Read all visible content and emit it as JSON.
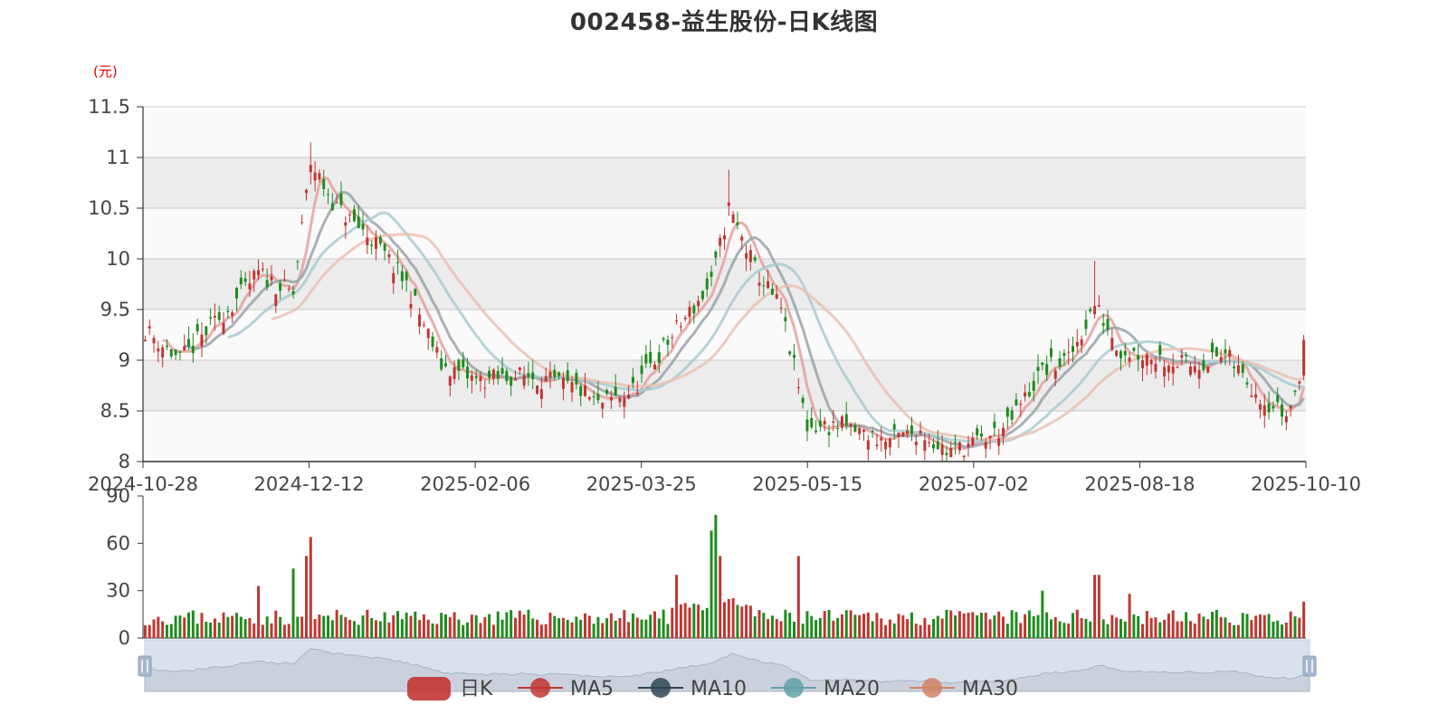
{
  "chart_data": [
    {
      "type": "candlestick",
      "title": "002458-益生股份-日K线图",
      "ylabel": "(元)",
      "ylim": [
        8,
        11.5
      ],
      "yticks": [
        "11.5",
        "11",
        "10.5",
        "10",
        "9.5",
        "9",
        "8.5",
        "8"
      ],
      "xticks": [
        "2024-10-28",
        "2024-12-12",
        "2025-02-06",
        "2025-03-25",
        "2025-05-15",
        "2025-07-02",
        "2025-08-18",
        "2025-10-10"
      ],
      "grid": true,
      "legend_position": "bottom-center",
      "colors": {
        "up": "#c23531",
        "down": "#1e8b1e",
        "ma5": "#e3a19f",
        "ma10": "#9aa3aa",
        "ma20": "#a9cdd1",
        "ma30": "#ebc1b3",
        "band": "#ececec",
        "gridline": "#c8c8c8"
      },
      "key_points": [
        {
          "label": "start",
          "price": 9.3
        },
        {
          "label": "2024-12 peak",
          "price": 11.15
        },
        {
          "label": "2025-02 low",
          "price": 8.5
        },
        {
          "label": "2025-04 peak",
          "price": 10.85
        },
        {
          "label": "2025-06 low",
          "price": 8.05
        },
        {
          "label": "2025-08 peak",
          "price": 9.95
        },
        {
          "label": "end",
          "price": 9.2
        }
      ],
      "series": [
        {
          "name": "日K",
          "type": "candlestick"
        },
        {
          "name": "MA5",
          "type": "line"
        },
        {
          "name": "MA10",
          "type": "line"
        },
        {
          "name": "MA20",
          "type": "line"
        },
        {
          "name": "MA30",
          "type": "line"
        }
      ]
    },
    {
      "type": "bar",
      "name": "volume",
      "ylim": [
        0,
        90
      ],
      "yticks": [
        "90",
        "60",
        "30",
        "0"
      ],
      "volume_peaks": [
        {
          "near": "2024-11-20",
          "value": 44
        },
        {
          "near": "2024-12-10",
          "value": 64
        },
        {
          "near": "2025-03-25",
          "value": 40
        },
        {
          "near": "2025-04-10",
          "value": 78
        },
        {
          "near": "2025-05-05",
          "value": 52
        },
        {
          "near": "2025-08-10",
          "value": 40
        }
      ]
    }
  ],
  "legend": [
    {
      "label": "日K",
      "color": "#c23531",
      "icon": "candle-legend-icon"
    },
    {
      "label": "MA5",
      "color": "#c23531",
      "icon": "circle-line-icon"
    },
    {
      "label": "MA10",
      "color": "#2f4554",
      "icon": "circle-line-icon"
    },
    {
      "label": "MA20",
      "color": "#61a0a8",
      "icon": "circle-line-icon"
    },
    {
      "label": "MA30",
      "color": "#d48265",
      "icon": "circle-line-icon"
    }
  ],
  "datazoom": {
    "range_start": 0,
    "range_end": 100
  }
}
